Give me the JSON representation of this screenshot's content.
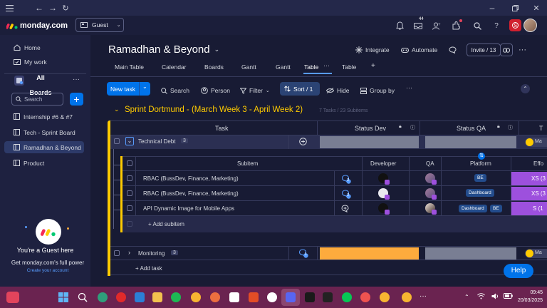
{
  "browser": {
    "profile_label": "Guest"
  },
  "app": {
    "logo_text": "monday.com",
    "updates_count": "44",
    "invite_label": "Invite / 13"
  },
  "sidebar": {
    "home": "Home",
    "my_work": "My work",
    "all_boards": "All Boards",
    "search_placeholder": "Search",
    "boards": [
      {
        "label": "Internship #6 & #7"
      },
      {
        "label": "Tech - Sprint Board"
      },
      {
        "label": "Ramadhan & Beyond"
      },
      {
        "label": "Product"
      }
    ],
    "guest_title": "You're a Guest here",
    "guest_sub": "Get monday.com's full power",
    "create_account": "Create your account"
  },
  "board": {
    "title": "Ramadhan & Beyond",
    "integrate": "Integrate",
    "automate": "Automate",
    "tabs": [
      "Main Table",
      "Calendar",
      "Boards",
      "Gantt",
      "Gantt",
      "Table",
      "Table"
    ],
    "toolbar": {
      "new_task": "New task",
      "search": "Search",
      "person": "Person",
      "filter": "Filter",
      "sort": "Sort / 1",
      "hide": "Hide",
      "group_by": "Group by"
    },
    "group": {
      "title": "Sprint Dortmund - (March Week 3 - April Week 2)",
      "meta": "7 Tasks / 23 Subitems",
      "col_task": "Task",
      "col_status_dev": "Status Dev",
      "col_status_qa": "Status QA",
      "col_t": "T"
    },
    "item_technical": {
      "name": "Technical Debt",
      "count": "3",
      "tag": "Ma"
    },
    "subitems": {
      "col_subitem": "Subitem",
      "col_developer": "Developer",
      "col_qa": "QA",
      "col_platform": "Platform",
      "col_effort": "Effo",
      "rows": [
        {
          "name": "RBAC (BussDev, Finance, Marketing)",
          "updates": "2",
          "platform": [
            "BE"
          ],
          "effort": "XS (3"
        },
        {
          "name": "RBAC (BussDev, Finance, Marketing)",
          "updates": "2",
          "platform": [
            "Dashboard"
          ],
          "effort": "XS (3"
        },
        {
          "name": "API Dynamic Image for Mobile Apps",
          "updates": "",
          "platform": [
            "Dashboard",
            "BE"
          ],
          "effort": "S (1"
        }
      ],
      "add_subitem": "+ Add subitem"
    },
    "item_monitoring": {
      "name": "Monitoring",
      "count": "3",
      "updates": "1",
      "tag": "Ma"
    },
    "add_task": "+ Add task",
    "help": "Help"
  },
  "taskbar": {
    "time": "09:45",
    "date": "20/03/2025"
  },
  "colors": {
    "accent_blue": "#0073ea",
    "group_yellow": "#ffcb00",
    "orange_status": "#fdab3d",
    "grey_status": "#797e93",
    "effort_purple": "#9d50dd",
    "platform_blue": "#225091"
  }
}
